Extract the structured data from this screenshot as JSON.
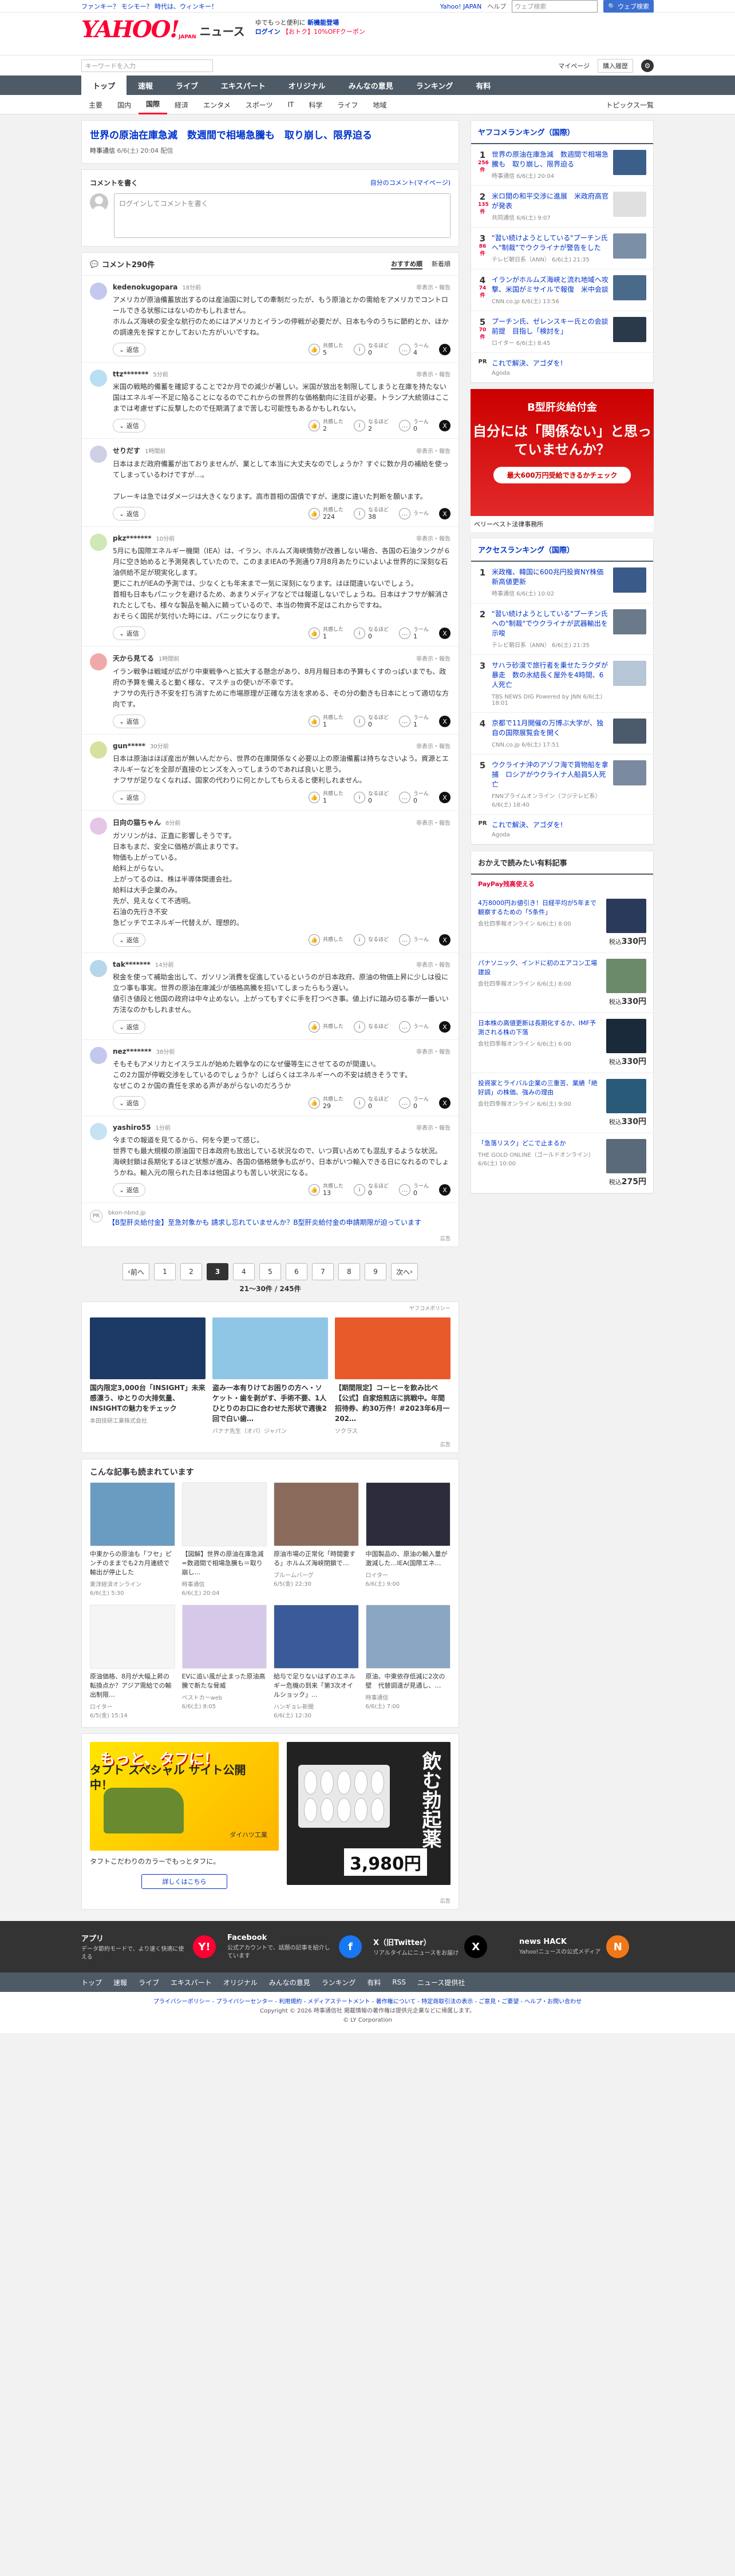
{
  "topbar": {
    "left": "ファンキー？ モシモー？ 時代は、ウィンキー！",
    "yahoo_link": "Yahoo! JAPAN",
    "help": "ヘルプ",
    "search_placeholder": "ウェブ検索",
    "search_button": "ウェブ検索"
  },
  "header": {
    "logo": "YAHOO!",
    "logo_sub": "JAPAN",
    "section": "ニュース",
    "promo_line1_a": "ゆでもっと便利に",
    "promo_line1_b": "新機能登場",
    "promo_line2_a": "ログイン",
    "promo_line2_b": "【おトク】10%OFFクーポン",
    "promo_line2_c": "お得",
    "search_placeholder": "キーワードを入力",
    "mypage": "マイページ",
    "purchase": "購入履歴"
  },
  "mainnav": [
    "トップ",
    "速報",
    "ライブ",
    "エキスパート",
    "オリジナル",
    "みんなの意見",
    "ランキング",
    "有料"
  ],
  "subnav": [
    "主要",
    "国内",
    "国際",
    "経済",
    "エンタメ",
    "スポーツ",
    "IT",
    "科学",
    "ライフ",
    "地域"
  ],
  "subnav_more": "トピックス一覧",
  "article": {
    "title": "世界の原油在庫急減　数週間で相場急騰も　取り崩し、限界迫る",
    "source": "時事通信",
    "date": "6/6(土) 20:04 配信"
  },
  "comment_write": {
    "heading": "コメントを書く",
    "settings_link": "自分のコメント(マイページ)",
    "placeholder": "ログインしてコメントを書く"
  },
  "comment_list": {
    "count": "コメント290件",
    "sort_recommended": "おすすめ順",
    "sort_newest": "新着順"
  },
  "labels": {
    "report": "非表示・報告",
    "reply": "返信",
    "empathy": "共感した",
    "insight": "なるほど",
    "doubt": "うーん"
  },
  "comments": [
    {
      "name": "kedenokugopara",
      "time": "18分前",
      "text": "アメリカが原油備蓄放出するのは産油国に対しての牽制だったが、もう原油とかの需給をアメリカでコントロールできる状態にはないのかもしれません。\nホルムズ海峡の安全な航行のためにはアメリカとイランの停戦が必要だが、日本も今のうちに節約とか、ほかの調達先を探すとかしておいた方がいいですね。",
      "empathy": "5",
      "insight": "0",
      "doubt": "4",
      "color": "#c4c8ee"
    },
    {
      "name": "ttz*******",
      "time": "5分前",
      "text": "米国の戦略的備蓄を確認することで2か月での減少が著しい。米国が放出を制限してしまうと在庫を持たない国はエネルギー不足に陥ることになるのでこれからの世界的な価格動向に注目が必要。トランプ大統領はここまでは考慮せずに反撃したので任期満了まで苦しむ可能性もあるかもしれない。",
      "empathy": "2",
      "insight": "2",
      "doubt": "0",
      "color": "#b8dff3"
    },
    {
      "name": "せりだす",
      "time": "1時間前",
      "text": "日本はまだ政府備蓄が出ておりませんが、業として本当に大丈夫なのでしょうか？すぐに数か月の補給を使ってしまっているわけですが…。\n\nプレーキは急ではダメージは大きくなります。高市首相の国債ですが、速度に違いた判断を願います。",
      "empathy": "224",
      "insight": "38",
      "doubt": "",
      "color": "#cfd0e6"
    },
    {
      "name": "pkz*******",
      "time": "10分前",
      "text": "5月にも国際エネルギー機関（IEA）は、イラン、ホルムズ海峡情勢が改善しない場合、各国の石油タンクが６月に空き始めると予測発表していたので、このままIEAの予測通り7月8月あたりにいよいよ世界的に深刻な石油供給不足が現実化します。\n更にこれがIEAの予測では、少なくとも年末まで一気に深刻になります。はほ間違いないでしょう。\n首相も日本もパニックを避けるため、あまりメディアなどでは報道しないでしょうね。日本はナフサが解消されたとしても、様々な製品を輸入に頼っているので、本当の物資不足はこれからですね。\nおそらく国民が気付いた時には、パニックになります。",
      "empathy": "1",
      "insight": "0",
      "doubt": "1",
      "color": "#cfe8b6"
    },
    {
      "name": "天から見てる",
      "time": "1時間前",
      "text": "イラン戦争は戦域が広がり中東戦争へと拡大する懸念があり、8月月報日本の予算もくすのっぱいまでも、政府の予算を備えると動く様な、マスチョの使いが不幸です。\nナフサの先行き不安を打ち消すために市場原理が正確な方法を求める、その分の動きも日本にとって適切な方向です。",
      "empathy": "1",
      "insight": "0",
      "doubt": "1",
      "color": "#f0a9a9"
    },
    {
      "name": "gun*****",
      "time": "30分前",
      "text": "日本は原油はほぼ産出が無いんだから、世界の在庫関係なく必要以上の原油備蓄は持ちなさいよう。資源とエネルギーなどを全部が直接のヒンズを入ってしまうのであれば良いと思う。\nナフサが足りなくなれば、国家の代わりに何とかしてもらえると便利しれません。",
      "empathy": "1",
      "insight": "0",
      "doubt": "0",
      "color": "#d8e0a0"
    },
    {
      "name": "日向の猫ちゃん",
      "time": "8分前",
      "text": "ガソリンがは、正直に影響しそうです。\n日本もまだ、安全に価格が高止まりです。\n物価も上がっている。\n給料上がらない。\n上がってるのは、株は半導体関連会社。\n給料は大手企業のみ。\n先が、見えなくて不透明。\n石油の先行き不安\n急ピッチでエネルギー代替えが、理想的。",
      "empathy": "",
      "insight": "",
      "doubt": "",
      "color": "#e6c6e6"
    },
    {
      "name": "tak*******",
      "time": "14分前",
      "text": "税金を使って補助金出して、ガソリン消費を促進しているというのが日本政府、原油の物価上昇に少しは役に立つ事も事実。世界の原油在庫減少が価格高騰を招いてしまったらもう遅い。\n値引き値段と他国の政府は中々止めない。上がってもすぐに手を打つべき事。値上げに踏み切る事が一番いい方法なのかもしれません。",
      "empathy": "",
      "insight": "",
      "doubt": "",
      "color": "#b6d6ea"
    },
    {
      "name": "nez*******",
      "time": "38分前",
      "text": "そもそもアメリカとイスラエルが始めた戦争なのになぜ優等生にさせてるのが間違い。\nこの2カ国が停戦交渉をしているのでしょうか？しばらくはエネルギーへの不安は続きそうです。\nなぜこの２か国の責任を求める声があがらないのだろうか",
      "empathy": "29",
      "insight": "0",
      "doubt": "0",
      "color": "#c4c8ee"
    },
    {
      "name": "yashiro55",
      "time": "1分前",
      "text": "今までの報道を見てるから、何を今更って感じ。\n世界でも最大規模の原油国で日本政府も放出している状況なので、いつ買い占めても混乱するような状況。\n海峡封鎖は長期化するほど状態が進み、各国の価格競争も広がり、日本がいつ輸入できる日になれるのでしょうかね。輸入元の限られた日本は他国よりも苦しい状況になる。",
      "empathy": "13",
      "insight": "0",
      "doubt": "0",
      "color": "#c7e2f2"
    }
  ],
  "pr": {
    "badge": "PR",
    "source": "bkon-nbnd.jp",
    "title": "【B型肝炎給付金】至急対象かも 請求し忘れていませんか？B型肝炎給付金の申請期限が迫っています",
    "foot": "広告"
  },
  "pager": {
    "prev": "前へ",
    "next": "次へ",
    "pages": [
      "1",
      "2",
      "3",
      "4",
      "5",
      "6",
      "7",
      "8",
      "9"
    ],
    "current": "3",
    "info": "21〜30件 / 245件"
  },
  "ads_row": {
    "label": "ヤフコメポリシー",
    "items": [
      {
        "title": "国内限定3,000台「INSIGHT」未来感漂う、ゆとりの大排気量、INSIGHTの魅力をチェック",
        "src": "本田技研工業株式会社",
        "color": "#1d3a66"
      },
      {
        "title": "盗み一本有りけてお困りの方へ・ソケット・歯を剥がす、手術不要、1人ひとりのお口に合わせた形状で週後2回で白い歯…",
        "src": "バナナ先生（オバ）ジャパン",
        "color": "#8fc6e6"
      },
      {
        "title": "【期間限定】コーヒーを飲み比べ【公式】自家焙煎店に挑戦中。年間招待券、約30万件！#2023年6月一202…",
        "src": "ソクラス",
        "color": "#e85a2a"
      }
    ],
    "foot": "広告"
  },
  "recommend": {
    "heading": "こんな記事も読まれています",
    "items": [
      {
        "title": "中東からの原油も「フセ」ピンチのままでも2カ月連続で輸出が停止した",
        "src": "東洋経済オンライン",
        "date": "6/6(土) 5:30",
        "color": "#6a9cc2"
      },
      {
        "title": "【図解】世界の原油在庫急減=数週間で相場急騰も＝取り崩し…",
        "src": "時事通信",
        "date": "6/6(土) 20:04",
        "color": "#f2f2f2"
      },
      {
        "title": "原油市場の正常化「時間要する」ホルムズ海峡閉鎖で…",
        "src": "ブルームバーグ",
        "date": "6/5(金) 22:30",
        "color": "#8a6a5a"
      },
      {
        "title": "中国製品の、原油の輸入量が激減した…IEA(国際エネ…",
        "src": "ロイター",
        "date": "6/6(土) 9:00",
        "color": "#2c2c3c"
      },
      {
        "title": "原油価格、8月が大幅上昇の転換点か？アジア需給での輸出制限…",
        "src": "ロイター",
        "date": "6/5(金) 15:14",
        "color": "#f5f5f5"
      },
      {
        "title": "EVに追い風が止まった原油高騰で新たな脅威",
        "src": "ベストカーweb",
        "date": "6/6(土) 8:05",
        "color": "#d6c8e8"
      },
      {
        "title": "給与で足りないはずのエネルギー危機の到来「第3次オイルショック」...",
        "src": "ハンギョレ新聞",
        "date": "6/6(土) 12:30",
        "color": "#3a5a9a"
      },
      {
        "title": "原油、中東依存低減に2次の壁　代替調達が見通し、…",
        "src": "時事通信",
        "date": "6/6(土) 7:00",
        "color": "#8aa6c2"
      }
    ]
  },
  "bigad": {
    "left_title": "もっと、タフに！",
    "left_copy": "タフト スペシャル サイト公開中！",
    "left_brand": "ダイハツ工業",
    "desc": "タフトこだわりのカラーでもっとタフに。",
    "more": "詳しくはこちら",
    "right_copy": "飲む勃起薬",
    "right_price": "3,980円",
    "foot": "広告"
  },
  "sidebar": {
    "ranking1": {
      "title": "ヤフコメランキング（国際）",
      "items": [
        {
          "num": "1",
          "cnt": "256件",
          "title": "世界の原油在庫急減　数週間で相場急騰も　取り崩し、限界迫る",
          "src": "時事通信 6/6(土) 20:04",
          "color": "#3c5f8a"
        },
        {
          "num": "2",
          "cnt": "135件",
          "title": "米ロ間の和平交渉に進展　米政府高官が発表",
          "src": "共同通信 6/6(土) 9:07",
          "color": "#e0e0e0"
        },
        {
          "num": "3",
          "cnt": "86件",
          "title": "\"習い続けようとしている\"プーチン氏へ\"制裁\"でウクライナが警告をした",
          "src": "テレビ朝日系（ANN） 6/6(土) 21:35",
          "color": "#7b8fa6"
        },
        {
          "num": "4",
          "cnt": "74件",
          "title": "イランがホルムズ海峡と流れ地域へ攻撃、米国がミサイルで報復　米中会談",
          "src": "CNN.co.jp 6/6(土) 13:56",
          "color": "#4a6a8a"
        },
        {
          "num": "5",
          "cnt": "70件",
          "title": "プーチン氏、ゼレンスキー氏との会談前提　目指し「検討を」",
          "src": "ロイター 6/6(土) 8:45",
          "color": "#2a3a4a"
        }
      ],
      "pr_title": "これで解決、アゴダを!",
      "pr_src": "Agoda"
    },
    "side_ad": {
      "title": "B型肝炎給付金",
      "headline": "自分には「関係ない」と思っていませんか？",
      "cta": "最大600万円受給できるかチェック",
      "sponsor": "ベリーベスト法律事務所"
    },
    "ranking2": {
      "title": "アクセスランキング（国際）",
      "items": [
        {
          "num": "1",
          "title": "米政権、韓国に600兆円投資NY株価新高値更新",
          "src": "時事通信 6/6(土) 10:02",
          "color": "#3a5a8a"
        },
        {
          "num": "2",
          "title": "\"習い続けようとしている\"プーチン氏への\"制裁\"でウクライナが武器輸出を示唆",
          "src": "テレビ朝日系（ANN） 6/6(土) 21:35",
          "color": "#6a7a8a"
        },
        {
          "num": "3",
          "title": "サハラ砂漠で旅行者を乗せたラクダが暴走　数の氷結長く屋外を4時間、6人死亡",
          "src": "TBS NEWS DIG Powered by JNN 6/6(土) 18:01",
          "color": "#b6c6d6"
        },
        {
          "num": "4",
          "title": "京都で11月開催の万博ぶ大学が、独自の国際展覧会を開く",
          "src": "CNN.co.jp 6/6(土) 17:51",
          "color": "#4a5a6a"
        },
        {
          "num": "5",
          "title": "ウクライナ沖のアゾフ海で貨物船を拿捕　ロシアがウクライナ人船員5人死亡",
          "src": "FNNプライムオンライン（フジテレビ系） 6/6(土) 18:40",
          "color": "#7a8aa0"
        }
      ],
      "pr_title": "これで解決、アゴダを!",
      "pr_src": "Agoda"
    },
    "shopping": {
      "title": "おかえで読みたい有料記事",
      "paypay": "PayPay残高使える",
      "items": [
        {
          "title": "4万8000円お値引き！日経平均が5年まで観察するための「5条件」",
          "src": "会社四季報オンライン 6/6(土) 8:00",
          "price_prefix": "税込",
          "price": "330円",
          "color": "#2a3a5a"
        },
        {
          "title": "パナソニック、インドに初のエアコン工場建設",
          "src": "会社四季報オンライン 6/6(土) 8:00",
          "price_prefix": "税込",
          "price": "330円",
          "color": "#6a8a6a"
        },
        {
          "title": "日本株の高値更新は長期化するか、IMF予測される株の下落",
          "src": "会社四季報オンライン 6/6(土) 6:00",
          "price_prefix": "税込",
          "price": "330円",
          "color": "#1a2a3a"
        },
        {
          "title": "投資家とライバル企業の三重苦、業績「絶好調」の株価、強みの理由",
          "src": "会社四季報オンライン 6/6(土) 9:00",
          "price_prefix": "税込",
          "price": "330円",
          "color": "#2a5a7a"
        },
        {
          "title": "「急落リスク」どこで止まるか",
          "src": "THE GOLD ONLINE（ゴールドオンライン） 6/6(土) 10:00",
          "price_prefix": "税込",
          "price": "275円",
          "color": "#5a6a7a"
        }
      ]
    }
  },
  "apps": [
    {
      "title": "アプリ",
      "desc": "データ節約モードで、より速く快適に使える",
      "icon": "Y!",
      "color": "#ff0033"
    },
    {
      "title": "Facebook",
      "desc": "公式アカウントで、話題の記事を紹介しています",
      "icon": "f",
      "color": "#1877f2"
    },
    {
      "title": "X（旧Twitter）",
      "desc": "リアルタイムにニュースをお届け",
      "icon": "X",
      "color": "#000000"
    },
    {
      "title": "news HACK",
      "desc": "Yahoo!ニュースの公式メディア",
      "icon": "N",
      "color": "#f07818"
    }
  ],
  "footer_nav": [
    "トップ",
    "速報",
    "ライブ",
    "エキスパート",
    "オリジナル",
    "みんなの意見",
    "ランキング",
    "有料",
    "RSS",
    "ニュース提供社"
  ],
  "footer_links": "プライバシーポリシー - プライバシーセンター - 利用規約 - メディアステートメント - 著作権について - 特定商取引法の表示 - ご意見・ご要望 - ヘルプ・お問い合わせ",
  "copyright": "Copyright © 2026 時事通信社 掲載情報の著作権は提供元企業などに帰属します。",
  "copyright2": "© LY Corporation"
}
